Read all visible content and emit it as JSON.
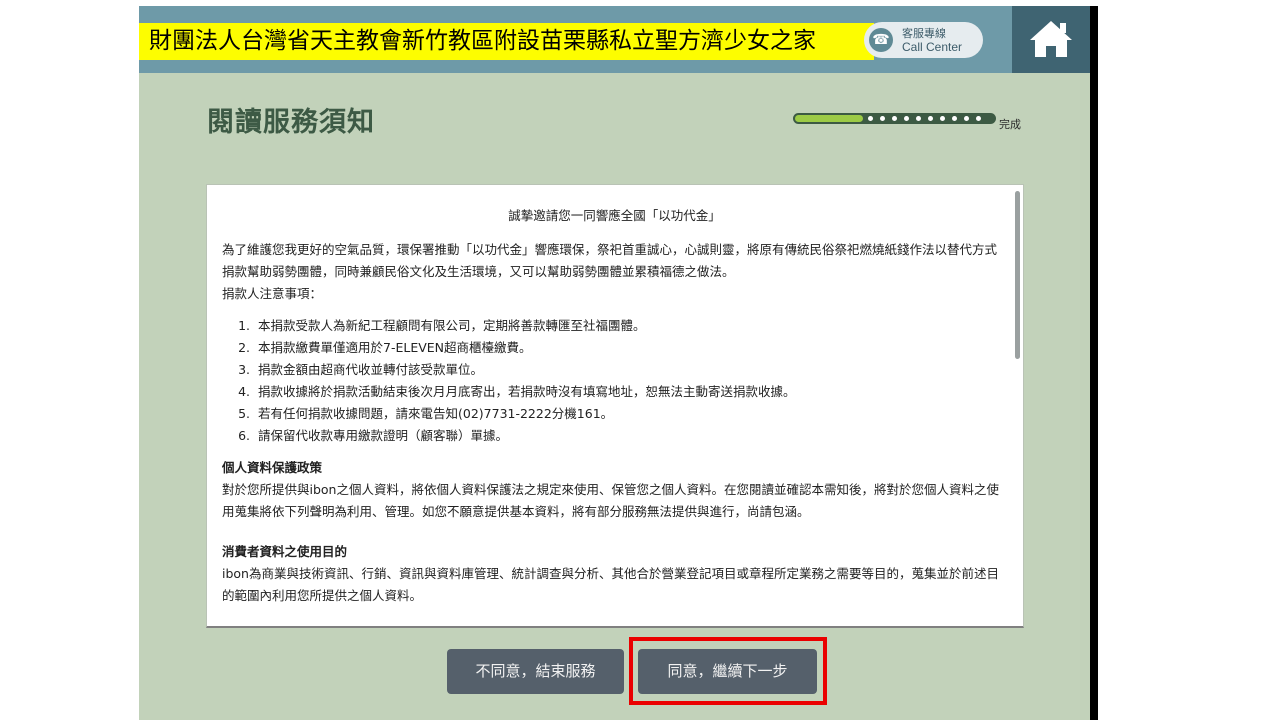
{
  "header": {
    "org_title": "財團法人台灣省天主教會新竹教區附設苗栗縣私立聖方濟少女之家",
    "call_center_line1": "客服專線",
    "call_center_line2": "Call Center"
  },
  "page": {
    "title": "閱讀服務須知",
    "progress_label": "完成",
    "progress_fraction": 0.34
  },
  "notice": {
    "title": "誠摯邀請您一同響應全國「以功代金」",
    "intro": "為了維護您我更好的空氣品質，環保署推動「以功代金」響應環保，祭祀首重誠心，心誠則靈，將原有傳統民俗祭祀燃燒紙錢作法以替代方式捐款幫助弱勢團體，同時兼顧民俗文化及生活環境，又可以幫助弱勢團體並累積福德之做法。",
    "notes_label": "捐款人注意事項：",
    "items": [
      "本捐款受款人為新紀工程顧問有限公司，定期將善款轉匯至社福團體。",
      "本捐款繳費單僅適用於7-ELEVEN超商櫃檯繳費。",
      "捐款金額由超商代收並轉付該受款單位。",
      "捐款收據將於捐款活動結束後次月月底寄出，若捐款時沒有填寫地址，恕無法主動寄送捐款收據。",
      "若有任何捐款收據問題，請來電告知(02)7731-2222分機161。",
      "請保留代收款專用繳款證明（顧客聯）單據。"
    ],
    "privacy_heading": "個人資料保護政策",
    "privacy_text": "對於您所提供與ibon之個人資料，將依個人資料保護法之規定來使用、保管您之個人資料。在您閱讀並確認本需知後，將對於您個人資料之使用蒐集將依下列聲明為利用、管理。如您不願意提供基本資料，將有部分服務無法提供與進行，尚請包涵。",
    "purpose_heading": "消費者資料之使用目的",
    "purpose_text": "ibon為商業與技術資訊、行銷、資訊與資料庫管理、統計調查與分析、其他合於營業登記項目或章程所定業務之需要等目的，蒐集並於前述目的範圍內利用您所提供之個人資料。"
  },
  "buttons": {
    "decline": "不同意，結束服務",
    "accept": "同意，繼續下一步"
  },
  "colors": {
    "background": "#c2d2ba",
    "topbar": "#6e9aa8",
    "home_box": "#3f6472",
    "banner": "#fdfd00",
    "button": "#55606b",
    "highlight": "#ea0000",
    "progress_fill": "#9ccb46"
  },
  "icons": [
    "home-icon",
    "phone-icon"
  ]
}
